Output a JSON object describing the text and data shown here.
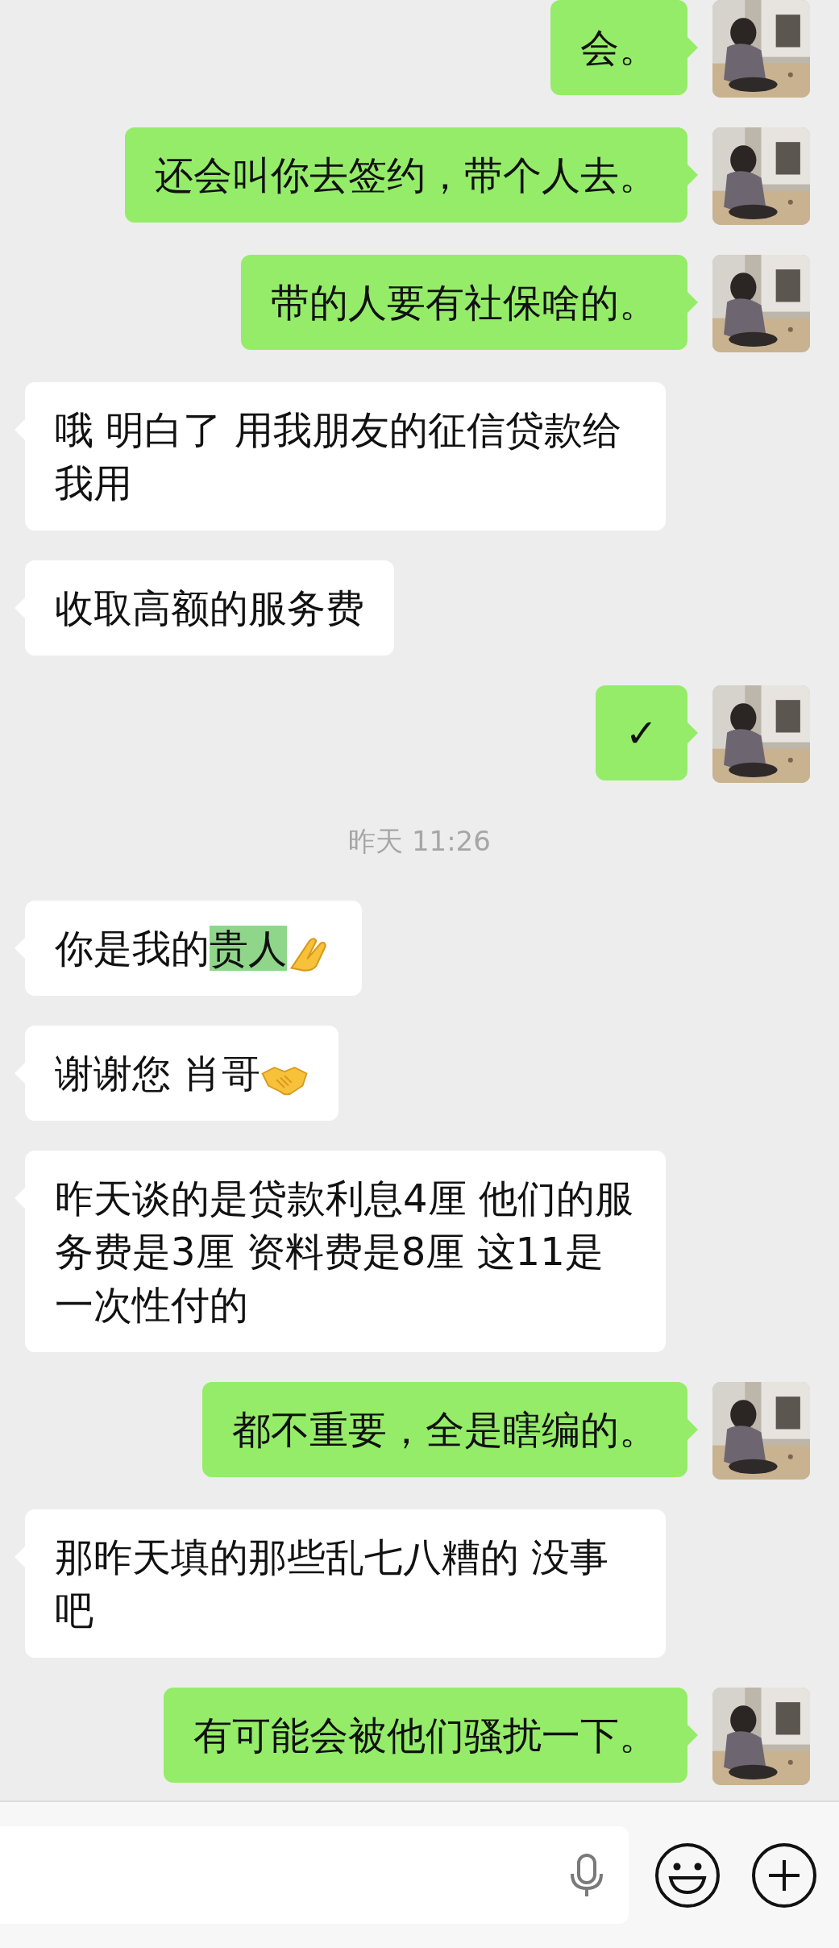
{
  "messages": [
    {
      "kind": "outgoing",
      "parts": [
        {
          "text": "会。",
          "highlighted": false
        }
      ]
    },
    {
      "kind": "outgoing",
      "parts": [
        {
          "text": "还会叫你去签约，带个人去。",
          "highlighted": false
        }
      ]
    },
    {
      "kind": "outgoing",
      "parts": [
        {
          "text": "带的人要有社保啥的。",
          "highlighted": false
        }
      ]
    },
    {
      "kind": "incoming",
      "parts": [
        {
          "text": "哦 明白了 用我朋友的征信贷款给我用",
          "highlighted": false
        }
      ]
    },
    {
      "kind": "incoming",
      "parts": [
        {
          "text": "收取高额的服务费",
          "highlighted": false
        }
      ]
    },
    {
      "kind": "outgoing",
      "parts": [
        {
          "text": "✓",
          "highlighted": false
        }
      ]
    },
    {
      "kind": "time",
      "text": "昨天 11:26"
    },
    {
      "kind": "incoming",
      "parts": [
        {
          "text": "你是我的",
          "highlighted": false
        },
        {
          "text": "贵人",
          "highlighted": true
        }
      ],
      "trailing_icon": {
        "kind": "okhand"
      }
    },
    {
      "kind": "incoming",
      "parts": [
        {
          "text": "谢谢您 肖哥",
          "highlighted": false
        }
      ],
      "trailing_icon": {
        "kind": "handshake"
      }
    },
    {
      "kind": "incoming",
      "parts": [
        {
          "text": "昨天谈的是贷款利息4厘 他们的服务费是3厘 资料费是8厘 这11是一次性付的",
          "highlighted": false
        }
      ]
    },
    {
      "kind": "outgoing",
      "parts": [
        {
          "text": "都不重要，全是瞎编的。",
          "highlighted": false
        }
      ]
    },
    {
      "kind": "incoming",
      "parts": [
        {
          "text": "那昨天填的那些乱七八糟的 没事吧",
          "highlighted": false
        }
      ]
    },
    {
      "kind": "outgoing",
      "parts": [
        {
          "text": "有可能会被他们骚扰一下。",
          "highlighted": false
        }
      ]
    }
  ]
}
